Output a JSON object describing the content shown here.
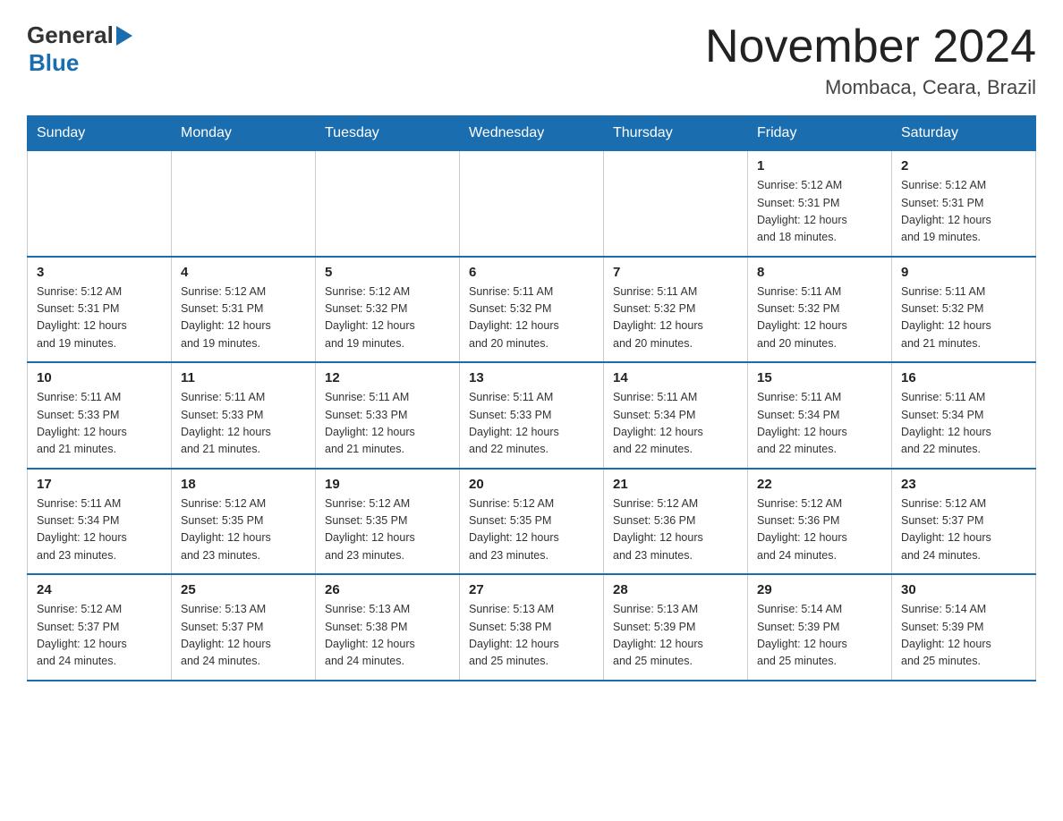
{
  "logo": {
    "general": "General",
    "blue": "Blue"
  },
  "title": "November 2024",
  "location": "Mombaca, Ceara, Brazil",
  "days_of_week": [
    "Sunday",
    "Monday",
    "Tuesday",
    "Wednesday",
    "Thursday",
    "Friday",
    "Saturday"
  ],
  "weeks": [
    [
      {
        "day": "",
        "info": ""
      },
      {
        "day": "",
        "info": ""
      },
      {
        "day": "",
        "info": ""
      },
      {
        "day": "",
        "info": ""
      },
      {
        "day": "",
        "info": ""
      },
      {
        "day": "1",
        "info": "Sunrise: 5:12 AM\nSunset: 5:31 PM\nDaylight: 12 hours\nand 18 minutes."
      },
      {
        "day": "2",
        "info": "Sunrise: 5:12 AM\nSunset: 5:31 PM\nDaylight: 12 hours\nand 19 minutes."
      }
    ],
    [
      {
        "day": "3",
        "info": "Sunrise: 5:12 AM\nSunset: 5:31 PM\nDaylight: 12 hours\nand 19 minutes."
      },
      {
        "day": "4",
        "info": "Sunrise: 5:12 AM\nSunset: 5:31 PM\nDaylight: 12 hours\nand 19 minutes."
      },
      {
        "day": "5",
        "info": "Sunrise: 5:12 AM\nSunset: 5:32 PM\nDaylight: 12 hours\nand 19 minutes."
      },
      {
        "day": "6",
        "info": "Sunrise: 5:11 AM\nSunset: 5:32 PM\nDaylight: 12 hours\nand 20 minutes."
      },
      {
        "day": "7",
        "info": "Sunrise: 5:11 AM\nSunset: 5:32 PM\nDaylight: 12 hours\nand 20 minutes."
      },
      {
        "day": "8",
        "info": "Sunrise: 5:11 AM\nSunset: 5:32 PM\nDaylight: 12 hours\nand 20 minutes."
      },
      {
        "day": "9",
        "info": "Sunrise: 5:11 AM\nSunset: 5:32 PM\nDaylight: 12 hours\nand 21 minutes."
      }
    ],
    [
      {
        "day": "10",
        "info": "Sunrise: 5:11 AM\nSunset: 5:33 PM\nDaylight: 12 hours\nand 21 minutes."
      },
      {
        "day": "11",
        "info": "Sunrise: 5:11 AM\nSunset: 5:33 PM\nDaylight: 12 hours\nand 21 minutes."
      },
      {
        "day": "12",
        "info": "Sunrise: 5:11 AM\nSunset: 5:33 PM\nDaylight: 12 hours\nand 21 minutes."
      },
      {
        "day": "13",
        "info": "Sunrise: 5:11 AM\nSunset: 5:33 PM\nDaylight: 12 hours\nand 22 minutes."
      },
      {
        "day": "14",
        "info": "Sunrise: 5:11 AM\nSunset: 5:34 PM\nDaylight: 12 hours\nand 22 minutes."
      },
      {
        "day": "15",
        "info": "Sunrise: 5:11 AM\nSunset: 5:34 PM\nDaylight: 12 hours\nand 22 minutes."
      },
      {
        "day": "16",
        "info": "Sunrise: 5:11 AM\nSunset: 5:34 PM\nDaylight: 12 hours\nand 22 minutes."
      }
    ],
    [
      {
        "day": "17",
        "info": "Sunrise: 5:11 AM\nSunset: 5:34 PM\nDaylight: 12 hours\nand 23 minutes."
      },
      {
        "day": "18",
        "info": "Sunrise: 5:12 AM\nSunset: 5:35 PM\nDaylight: 12 hours\nand 23 minutes."
      },
      {
        "day": "19",
        "info": "Sunrise: 5:12 AM\nSunset: 5:35 PM\nDaylight: 12 hours\nand 23 minutes."
      },
      {
        "day": "20",
        "info": "Sunrise: 5:12 AM\nSunset: 5:35 PM\nDaylight: 12 hours\nand 23 minutes."
      },
      {
        "day": "21",
        "info": "Sunrise: 5:12 AM\nSunset: 5:36 PM\nDaylight: 12 hours\nand 23 minutes."
      },
      {
        "day": "22",
        "info": "Sunrise: 5:12 AM\nSunset: 5:36 PM\nDaylight: 12 hours\nand 24 minutes."
      },
      {
        "day": "23",
        "info": "Sunrise: 5:12 AM\nSunset: 5:37 PM\nDaylight: 12 hours\nand 24 minutes."
      }
    ],
    [
      {
        "day": "24",
        "info": "Sunrise: 5:12 AM\nSunset: 5:37 PM\nDaylight: 12 hours\nand 24 minutes."
      },
      {
        "day": "25",
        "info": "Sunrise: 5:13 AM\nSunset: 5:37 PM\nDaylight: 12 hours\nand 24 minutes."
      },
      {
        "day": "26",
        "info": "Sunrise: 5:13 AM\nSunset: 5:38 PM\nDaylight: 12 hours\nand 24 minutes."
      },
      {
        "day": "27",
        "info": "Sunrise: 5:13 AM\nSunset: 5:38 PM\nDaylight: 12 hours\nand 25 minutes."
      },
      {
        "day": "28",
        "info": "Sunrise: 5:13 AM\nSunset: 5:39 PM\nDaylight: 12 hours\nand 25 minutes."
      },
      {
        "day": "29",
        "info": "Sunrise: 5:14 AM\nSunset: 5:39 PM\nDaylight: 12 hours\nand 25 minutes."
      },
      {
        "day": "30",
        "info": "Sunrise: 5:14 AM\nSunset: 5:39 PM\nDaylight: 12 hours\nand 25 minutes."
      }
    ]
  ]
}
